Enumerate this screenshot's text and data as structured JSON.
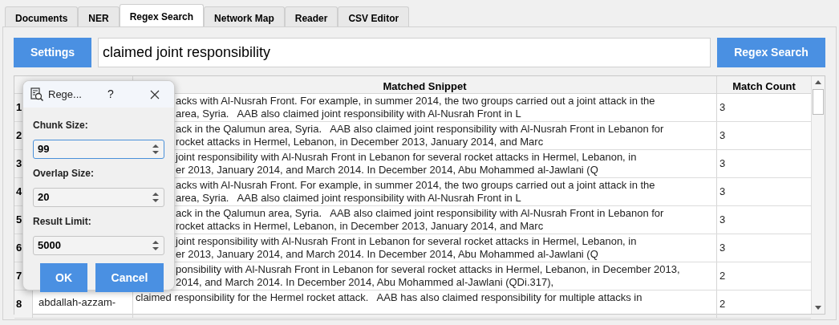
{
  "tabs": [
    {
      "label": "Documents",
      "selected": false
    },
    {
      "label": "NER",
      "selected": false
    },
    {
      "label": "Regex Search",
      "selected": true
    },
    {
      "label": "Network Map",
      "selected": false
    },
    {
      "label": "Reader",
      "selected": false
    },
    {
      "label": "CSV Editor",
      "selected": false
    }
  ],
  "toolbar": {
    "settings_button": "Settings",
    "query": "claimed joint responsibility",
    "search_button": "Regex Search"
  },
  "table": {
    "columns": [
      "Matched Snippet",
      "Match Count"
    ],
    "rows": [
      {
        "number": "1",
        "lines": [
          "acks with Al-Nusrah Front. For example, in summer 2014, the two groups carried out a joint attack in the",
          "area, Syria.   AAB also claimed joint responsibility with Al-Nusrah Front in L"
        ],
        "count": "3"
      },
      {
        "number": "2",
        "lines": [
          "ack in the Qalumun area, Syria.   AAB also claimed joint responsibility with Al-Nusrah Front in Lebanon for",
          "rocket attacks in Hermel, Lebanon, in December 2013, January 2014, and Marc"
        ],
        "count": "3"
      },
      {
        "number": "3",
        "lines": [
          "joint responsibility with Al-Nusrah Front in Lebanon for several rocket attacks in Hermel, Lebanon, in",
          "er 2013, January 2014, and March 2014. In December 2014, Abu Mohammed al-Jawlani (Q"
        ],
        "count": "3"
      },
      {
        "number": "4",
        "lines": [
          "acks with Al-Nusrah Front. For example, in summer 2014, the two groups carried out a joint attack in the",
          "area, Syria.   AAB also claimed joint responsibility with Al-Nusrah Front in L"
        ],
        "count": "3"
      },
      {
        "number": "5",
        "lines": [
          "ack in the Qalumun area, Syria.   AAB also claimed joint responsibility with Al-Nusrah Front in Lebanon for",
          "rocket attacks in Hermel, Lebanon, in December 2013, January 2014, and Marc"
        ],
        "count": "3"
      },
      {
        "number": "6",
        "lines": [
          "joint responsibility with Al-Nusrah Front in Lebanon for several rocket attacks in Hermel, Lebanon, in",
          "er 2013, January 2014, and March 2014. In December 2014, Abu Mohammed al-Jawlani (Q"
        ],
        "count": "3"
      },
      {
        "number": "7",
        "lines": [
          "ponsibility with Al-Nusrah Front in Lebanon for several rocket attacks in Hermel, Lebanon, in December 2013,",
          "2014, and March 2014. In December 2014, Abu Mohammed al-Jawlani (QDi.317),"
        ],
        "count": "2"
      },
      {
        "number": "8",
        "name": "abdallah-azzam-",
        "lines": [
          "claimed responsibility for the Hermel rocket attack.   AAB has also claimed responsibility for multiple attacks in"
        ],
        "count": "2"
      }
    ]
  },
  "dialog": {
    "title": "Rege...",
    "help": "?",
    "fields": [
      {
        "label": "Chunk Size:",
        "value": "99",
        "focused": true
      },
      {
        "label": "Overlap Size:",
        "value": "20",
        "focused": false
      },
      {
        "label": "Result Limit:",
        "value": "5000",
        "focused": false
      }
    ],
    "buttons": [
      "OK",
      "Cancel"
    ]
  }
}
